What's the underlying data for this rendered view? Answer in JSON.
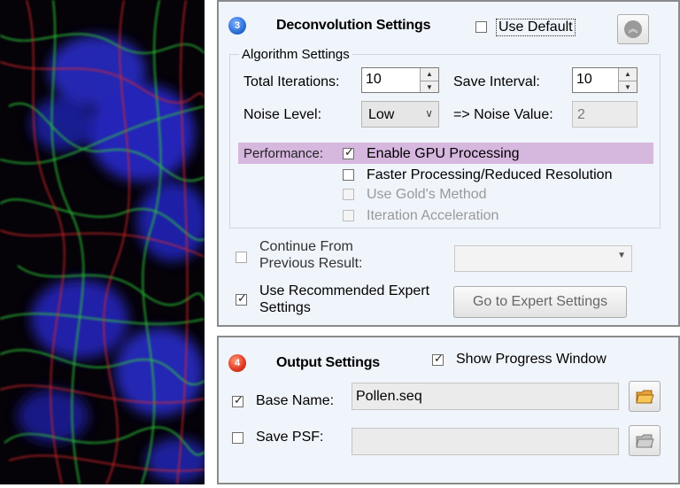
{
  "deconvolution": {
    "step": "3",
    "title": "Deconvolution Settings",
    "use_default_label": "Use Default",
    "use_default_checked": false,
    "collapse_icon": "chevron-up-icon",
    "algorithm": {
      "group_title": "Algorithm Settings",
      "total_iterations_label": "Total Iterations:",
      "total_iterations_value": "10",
      "save_interval_label": "Save Interval:",
      "save_interval_value": "10",
      "noise_level_label": "Noise Level:",
      "noise_level_value": "Low",
      "noise_value_label": "=> Noise Value:",
      "noise_value": "2",
      "performance_label": "Performance:",
      "options": [
        {
          "label": "Enable GPU Processing",
          "checked": true,
          "enabled": true
        },
        {
          "label": "Faster Processing/Reduced Resolution",
          "checked": false,
          "enabled": true
        },
        {
          "label": "Use Gold's Method",
          "checked": false,
          "enabled": false
        },
        {
          "label": "Iteration Acceleration",
          "checked": false,
          "enabled": false
        }
      ]
    },
    "continue_label_1": "Continue From",
    "continue_label_2": "Previous Result:",
    "continue_checked": false,
    "continue_select_value": "",
    "expert_label_1": "Use Recommended Expert",
    "expert_label_2": "Settings",
    "expert_checked": true,
    "expert_button_label": "Go to Expert Settings"
  },
  "output": {
    "step": "4",
    "title": "Output Settings",
    "show_progress_label": "Show Progress Window",
    "show_progress_checked": true,
    "base_name_label": "Base Name:",
    "base_name_checked": true,
    "base_name_value": "Pollen.seq",
    "save_psf_label": "Save PSF:",
    "save_psf_checked": false,
    "save_psf_value": "",
    "folder_icon": "folder-icon"
  },
  "colors": {
    "panel_bg": "#f0f4fb",
    "highlight": "#d6b7de",
    "step3": "#2a6fd6",
    "step4": "#e0371f",
    "image_bg": "#050208"
  },
  "image": {
    "description_icon": "fluorescence-micrograph"
  }
}
